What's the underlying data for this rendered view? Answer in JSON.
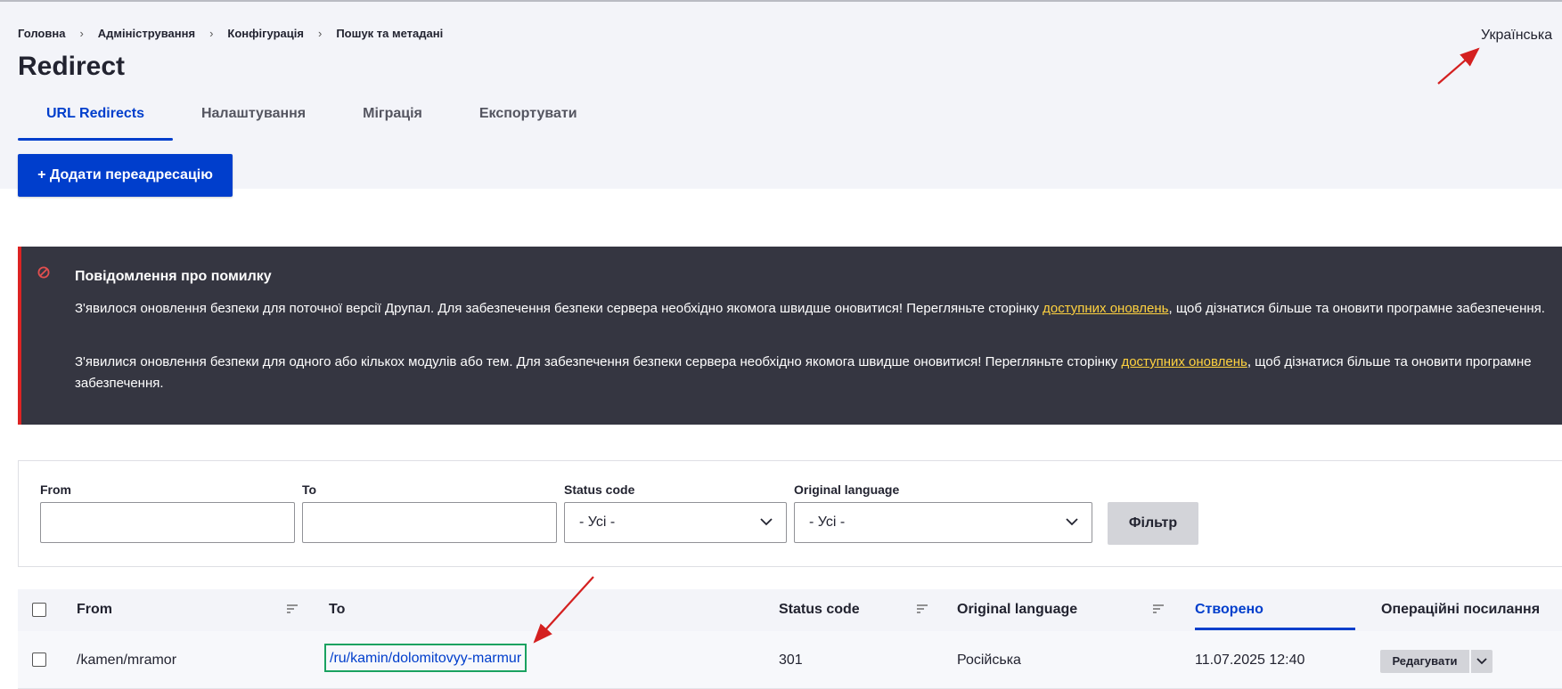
{
  "breadcrumb": [
    {
      "label": "Головна"
    },
    {
      "label": "Адміністрування"
    },
    {
      "label": "Конфігурація"
    },
    {
      "label": "Пошук та метадані"
    }
  ],
  "language_switcher": "Українська",
  "page_title": "Redirect",
  "tabs": [
    {
      "label": "URL Redirects",
      "active": true
    },
    {
      "label": "Налаштування",
      "active": false
    },
    {
      "label": "Міграція",
      "active": false
    },
    {
      "label": "Експортувати",
      "active": false
    }
  ],
  "add_button": "+ Додати переадресацію",
  "error_message": {
    "title": "Повідомлення про помилку",
    "msg1_before": "З'явилося оновлення безпеки для поточної версії Друпал. Для забезпечення безпеки сервера необхідно якомога швидше оновитися! Перегляньте сторінку ",
    "msg1_link": "доступних оновлень",
    "msg1_after": ", щоб дізнатися більше та оновити програмне забезпечення.",
    "msg2_before": "З'явилися оновлення безпеки для одного або кількох модулів або тем. Для забезпечення безпеки сервера необхідно якомога швидше оновитися! Перегляньте сторінку ",
    "msg2_link": "доступних оновлень",
    "msg2_after": ", щоб дізнатися більше та оновити програмне забезпечення."
  },
  "filters": {
    "from_label": "From",
    "to_label": "To",
    "status_label": "Status code",
    "status_value": "- Усі -",
    "language_label": "Original language",
    "language_value": "- Усі -",
    "submit": "Фільтр"
  },
  "table": {
    "headers": {
      "from": "From",
      "to": "To",
      "status": "Status code",
      "language": "Original language",
      "created": "Створено",
      "operations": "Операційні посилання"
    },
    "rows": [
      {
        "from": "/kamen/mramor",
        "to": "/ru/kamin/dolomitovyy-marmur",
        "status": "301",
        "language": "Російська",
        "created": "11.07.2025 12:40",
        "edit": "Редагувати"
      }
    ]
  },
  "colors": {
    "accent": "#003ecc",
    "error_bg": "#353641",
    "error_border": "#dc2323",
    "error_link": "#ffd23f",
    "highlight_box": "#1aa260",
    "annotation_arrow": "#d42020"
  }
}
